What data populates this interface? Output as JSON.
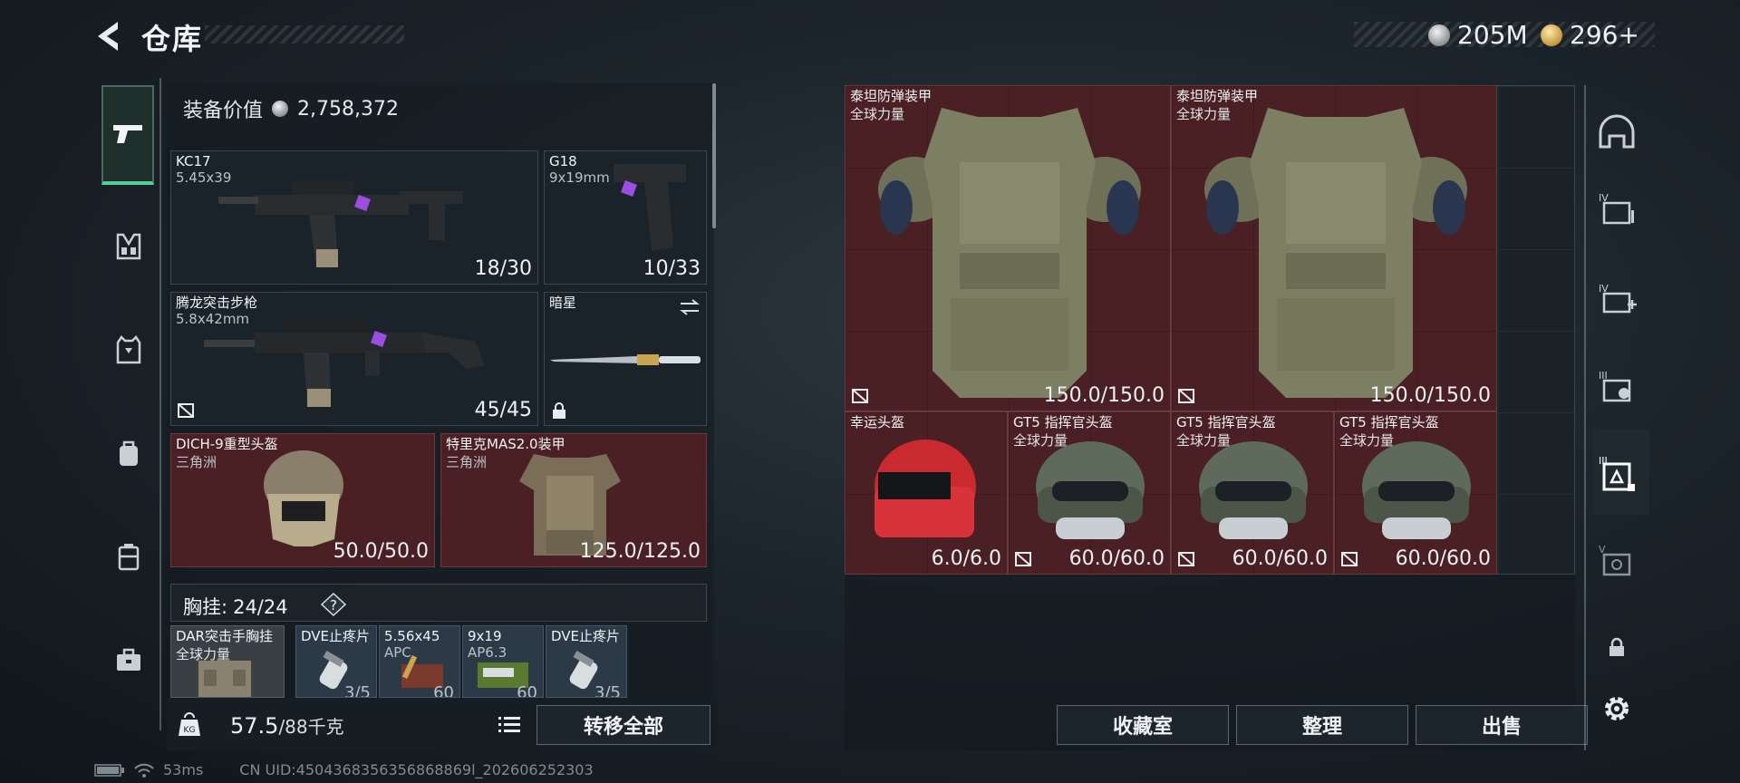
{
  "header": {
    "title": "仓库",
    "currencies": [
      {
        "icon": "silver-coin-icon",
        "value": "205M"
      },
      {
        "icon": "gold-coin-icon",
        "value": "296+"
      }
    ]
  },
  "left_nav": {
    "items": [
      "pistol-icon",
      "chest-rig-icon",
      "armor-vest-icon",
      "backpack-icon",
      "case-icon",
      "toolbox-icon"
    ]
  },
  "equipment": {
    "value_label": "装备价值",
    "value": "2,758,372",
    "slots": [
      {
        "name": "KC17",
        "sub": "5.45x39",
        "count": "18/30"
      },
      {
        "name": "G18",
        "sub": "9x19mm",
        "count": "10/33"
      },
      {
        "name": "腾龙突击步枪",
        "sub": "5.8x42mm",
        "count": "45/45"
      },
      {
        "name": "暗星",
        "sub": "",
        "count": ""
      },
      {
        "name": "DICH-9重型头盔",
        "sub": "三角洲",
        "count": "50.0/50.0"
      },
      {
        "name": "特里克MAS2.0装甲",
        "sub": "三角洲",
        "count": "125.0/125.0"
      }
    ]
  },
  "chest_rig": {
    "label": "胸挂:",
    "capacity": "24/24",
    "help": "?",
    "items": [
      {
        "name": "DAR突击手胸挂",
        "sub": "全球力量",
        "count": ""
      },
      {
        "name": "DVE止疼片",
        "sub": "",
        "count": "3/5"
      },
      {
        "name": "5.56x45",
        "sub": "APC",
        "count": "60"
      },
      {
        "name": "9x19",
        "sub": "AP6.3",
        "count": "60"
      },
      {
        "name": "DVE止疼片",
        "sub": "",
        "count": "3/5"
      }
    ]
  },
  "footer": {
    "weight": "57.5",
    "weight_cap": "/88千克",
    "transfer_all": "转移全部"
  },
  "status": {
    "ping": "53ms",
    "uid": "CN UID:4504368356356868869l_202606252303"
  },
  "storage": {
    "items": [
      {
        "name": "泰坦防弹装甲",
        "sub": "全球力量",
        "count": "150.0/150.0"
      },
      {
        "name": "泰坦防弹装甲",
        "sub": "全球力量",
        "count": "150.0/150.0"
      },
      {
        "name": "幸运头盔",
        "sub": "",
        "count": "6.0/6.0"
      },
      {
        "name": "GT5 指挥官头盔",
        "sub": "全球力量",
        "count": "60.0/60.0"
      },
      {
        "name": "GT5 指挥官头盔",
        "sub": "全球力量",
        "count": "60.0/60.0"
      },
      {
        "name": "GT5 指挥官头盔",
        "sub": "全球力量",
        "count": "60.0/60.0"
      }
    ],
    "actions": [
      "收藏室",
      "整理",
      "出售"
    ]
  },
  "right_nav": {
    "items": [
      "helmet-icon",
      "level-iv-folder-icon",
      "level-iv-add-icon",
      "level-iii-icon",
      "level-iii-active-icon",
      "level-v-icon",
      "lock-icon",
      "settings-gear-icon"
    ]
  },
  "colors": {
    "accent_green": "#4fd09a",
    "item_red_bg": "#4b2025",
    "panel_bg": "#1b232a"
  }
}
